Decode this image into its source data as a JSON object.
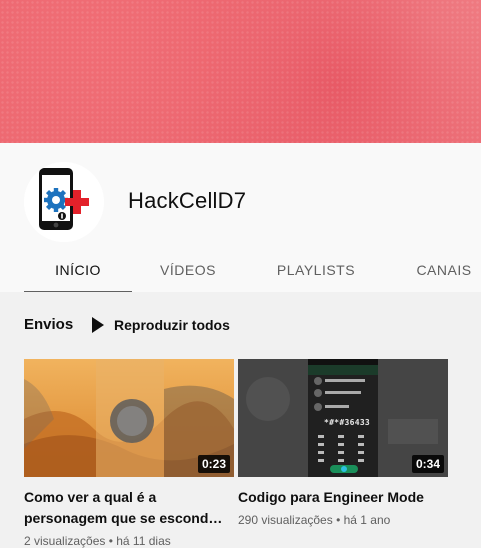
{
  "channel": {
    "name": "HackCellD7"
  },
  "tabs": [
    {
      "label": "INÍCIO"
    },
    {
      "label": "VÍDEOS"
    },
    {
      "label": "PLAYLISTS"
    },
    {
      "label": "CANAIS"
    }
  ],
  "section": {
    "title": "Envios",
    "play_all_label": "Reproduzir todos"
  },
  "videos": [
    {
      "title": "Como ver a qual é a personagem que se escond…",
      "duration": "0:23",
      "views": "2 visualizações",
      "age": "há 11 dias"
    },
    {
      "title": "Codigo para Engineer Mode",
      "duration": "0:34",
      "views": "290 visualizações",
      "age": "há 1 ano",
      "screen_code": "*#*#36433"
    }
  ],
  "separator": " • ",
  "colors": {
    "banner": "#ec6770",
    "brand_red": "#e3212a",
    "brand_blue": "#1e73be"
  }
}
